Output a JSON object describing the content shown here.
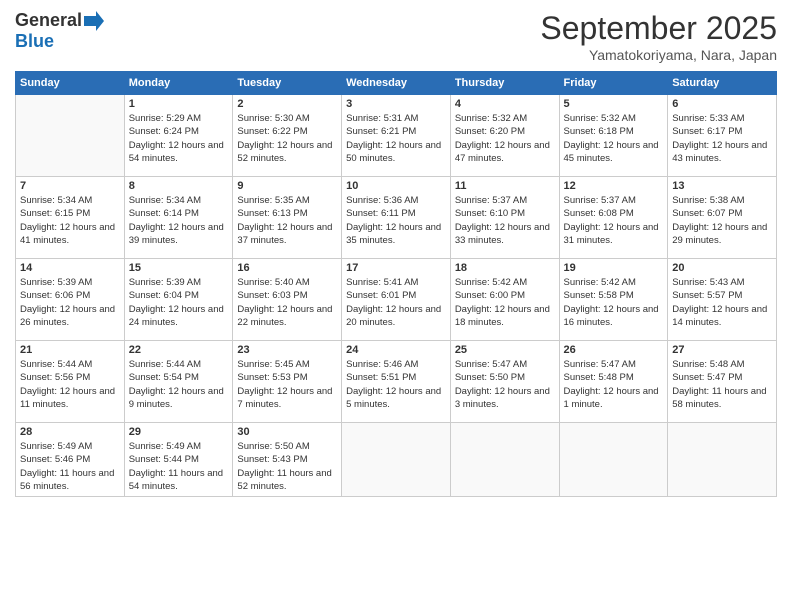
{
  "header": {
    "logo_general": "General",
    "logo_blue": "Blue",
    "month": "September 2025",
    "location": "Yamatokoriyama, Nara, Japan"
  },
  "days_of_week": [
    "Sunday",
    "Monday",
    "Tuesday",
    "Wednesday",
    "Thursday",
    "Friday",
    "Saturday"
  ],
  "weeks": [
    [
      {
        "day": "",
        "empty": true
      },
      {
        "day": "1",
        "sunrise": "Sunrise: 5:29 AM",
        "sunset": "Sunset: 6:24 PM",
        "daylight": "Daylight: 12 hours and 54 minutes."
      },
      {
        "day": "2",
        "sunrise": "Sunrise: 5:30 AM",
        "sunset": "Sunset: 6:22 PM",
        "daylight": "Daylight: 12 hours and 52 minutes."
      },
      {
        "day": "3",
        "sunrise": "Sunrise: 5:31 AM",
        "sunset": "Sunset: 6:21 PM",
        "daylight": "Daylight: 12 hours and 50 minutes."
      },
      {
        "day": "4",
        "sunrise": "Sunrise: 5:32 AM",
        "sunset": "Sunset: 6:20 PM",
        "daylight": "Daylight: 12 hours and 47 minutes."
      },
      {
        "day": "5",
        "sunrise": "Sunrise: 5:32 AM",
        "sunset": "Sunset: 6:18 PM",
        "daylight": "Daylight: 12 hours and 45 minutes."
      },
      {
        "day": "6",
        "sunrise": "Sunrise: 5:33 AM",
        "sunset": "Sunset: 6:17 PM",
        "daylight": "Daylight: 12 hours and 43 minutes."
      }
    ],
    [
      {
        "day": "7",
        "sunrise": "Sunrise: 5:34 AM",
        "sunset": "Sunset: 6:15 PM",
        "daylight": "Daylight: 12 hours and 41 minutes."
      },
      {
        "day": "8",
        "sunrise": "Sunrise: 5:34 AM",
        "sunset": "Sunset: 6:14 PM",
        "daylight": "Daylight: 12 hours and 39 minutes."
      },
      {
        "day": "9",
        "sunrise": "Sunrise: 5:35 AM",
        "sunset": "Sunset: 6:13 PM",
        "daylight": "Daylight: 12 hours and 37 minutes."
      },
      {
        "day": "10",
        "sunrise": "Sunrise: 5:36 AM",
        "sunset": "Sunset: 6:11 PM",
        "daylight": "Daylight: 12 hours and 35 minutes."
      },
      {
        "day": "11",
        "sunrise": "Sunrise: 5:37 AM",
        "sunset": "Sunset: 6:10 PM",
        "daylight": "Daylight: 12 hours and 33 minutes."
      },
      {
        "day": "12",
        "sunrise": "Sunrise: 5:37 AM",
        "sunset": "Sunset: 6:08 PM",
        "daylight": "Daylight: 12 hours and 31 minutes."
      },
      {
        "day": "13",
        "sunrise": "Sunrise: 5:38 AM",
        "sunset": "Sunset: 6:07 PM",
        "daylight": "Daylight: 12 hours and 29 minutes."
      }
    ],
    [
      {
        "day": "14",
        "sunrise": "Sunrise: 5:39 AM",
        "sunset": "Sunset: 6:06 PM",
        "daylight": "Daylight: 12 hours and 26 minutes."
      },
      {
        "day": "15",
        "sunrise": "Sunrise: 5:39 AM",
        "sunset": "Sunset: 6:04 PM",
        "daylight": "Daylight: 12 hours and 24 minutes."
      },
      {
        "day": "16",
        "sunrise": "Sunrise: 5:40 AM",
        "sunset": "Sunset: 6:03 PM",
        "daylight": "Daylight: 12 hours and 22 minutes."
      },
      {
        "day": "17",
        "sunrise": "Sunrise: 5:41 AM",
        "sunset": "Sunset: 6:01 PM",
        "daylight": "Daylight: 12 hours and 20 minutes."
      },
      {
        "day": "18",
        "sunrise": "Sunrise: 5:42 AM",
        "sunset": "Sunset: 6:00 PM",
        "daylight": "Daylight: 12 hours and 18 minutes."
      },
      {
        "day": "19",
        "sunrise": "Sunrise: 5:42 AM",
        "sunset": "Sunset: 5:58 PM",
        "daylight": "Daylight: 12 hours and 16 minutes."
      },
      {
        "day": "20",
        "sunrise": "Sunrise: 5:43 AM",
        "sunset": "Sunset: 5:57 PM",
        "daylight": "Daylight: 12 hours and 14 minutes."
      }
    ],
    [
      {
        "day": "21",
        "sunrise": "Sunrise: 5:44 AM",
        "sunset": "Sunset: 5:56 PM",
        "daylight": "Daylight: 12 hours and 11 minutes."
      },
      {
        "day": "22",
        "sunrise": "Sunrise: 5:44 AM",
        "sunset": "Sunset: 5:54 PM",
        "daylight": "Daylight: 12 hours and 9 minutes."
      },
      {
        "day": "23",
        "sunrise": "Sunrise: 5:45 AM",
        "sunset": "Sunset: 5:53 PM",
        "daylight": "Daylight: 12 hours and 7 minutes."
      },
      {
        "day": "24",
        "sunrise": "Sunrise: 5:46 AM",
        "sunset": "Sunset: 5:51 PM",
        "daylight": "Daylight: 12 hours and 5 minutes."
      },
      {
        "day": "25",
        "sunrise": "Sunrise: 5:47 AM",
        "sunset": "Sunset: 5:50 PM",
        "daylight": "Daylight: 12 hours and 3 minutes."
      },
      {
        "day": "26",
        "sunrise": "Sunrise: 5:47 AM",
        "sunset": "Sunset: 5:48 PM",
        "daylight": "Daylight: 12 hours and 1 minute."
      },
      {
        "day": "27",
        "sunrise": "Sunrise: 5:48 AM",
        "sunset": "Sunset: 5:47 PM",
        "daylight": "Daylight: 11 hours and 58 minutes."
      }
    ],
    [
      {
        "day": "28",
        "sunrise": "Sunrise: 5:49 AM",
        "sunset": "Sunset: 5:46 PM",
        "daylight": "Daylight: 11 hours and 56 minutes."
      },
      {
        "day": "29",
        "sunrise": "Sunrise: 5:49 AM",
        "sunset": "Sunset: 5:44 PM",
        "daylight": "Daylight: 11 hours and 54 minutes."
      },
      {
        "day": "30",
        "sunrise": "Sunrise: 5:50 AM",
        "sunset": "Sunset: 5:43 PM",
        "daylight": "Daylight: 11 hours and 52 minutes."
      },
      {
        "day": "",
        "empty": true
      },
      {
        "day": "",
        "empty": true
      },
      {
        "day": "",
        "empty": true
      },
      {
        "day": "",
        "empty": true
      }
    ]
  ]
}
